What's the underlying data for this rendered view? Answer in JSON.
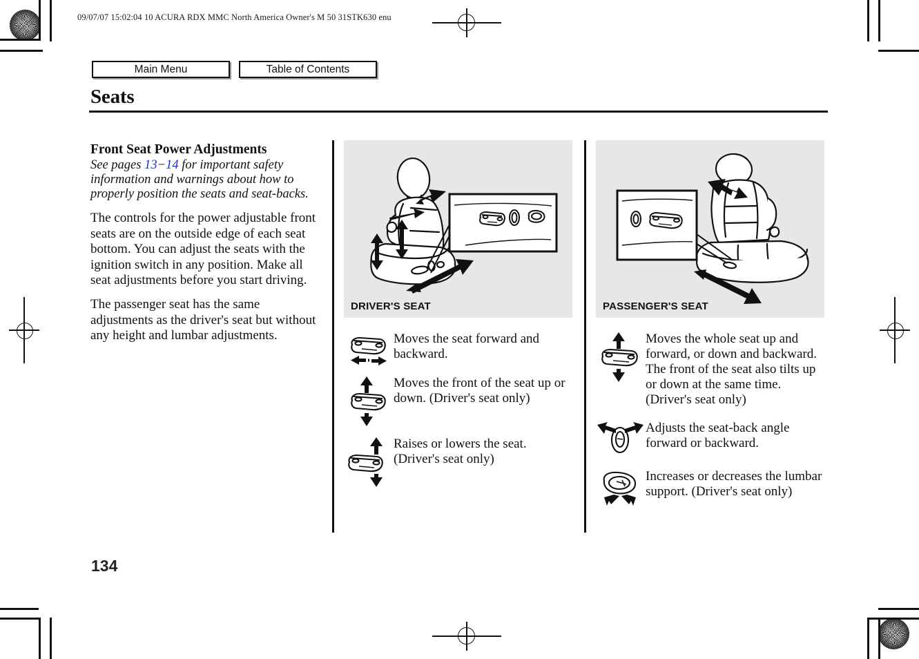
{
  "print_header": {
    "code_line": "09/07/07 15:02:04    10 ACURA RDX MMC North America Owner's M 50 31STK630 enu"
  },
  "nav": {
    "main_menu_label": "Main Menu",
    "table_of_contents_label": "Table of Contents"
  },
  "page": {
    "title": "Seats",
    "number": "134"
  },
  "left_column": {
    "section_heading": "Front Seat Power Adjustments",
    "safety_note": {
      "prefix": "See pages ",
      "page_link_1": "13",
      "dash": "−",
      "page_link_2": "14",
      "suffix": " for important safety information and warnings about how to properly position the seats and seat-backs.",
      "link_color": "#1a2fd0"
    },
    "paragraph_1": "The controls for the power adjustable front seats are on the outside edge of each seat bottom. You can adjust the seats with the ignition switch in any position. Make all seat adjustments before you start driving.",
    "paragraph_2": "The passenger seat has the same adjustments as the driver's seat but without any height and lumbar adjustments."
  },
  "middle_column": {
    "illustration_caption": "DRIVER'S SEAT",
    "illustration_name": "drivers-seat-diagram",
    "panel_bg": "#e7e7e7",
    "controls": [
      {
        "icon": "slide-switch-forward-backward-icon",
        "text": "Moves the seat forward and backward."
      },
      {
        "icon": "slide-switch-front-tilt-icon",
        "text": "Moves the front of the seat up or down. (Driver's seat only)"
      },
      {
        "icon": "slide-switch-height-icon",
        "text": "Raises or lowers the seat. (Driver's seat only)"
      }
    ]
  },
  "right_column": {
    "illustration_caption": "PASSENGER'S SEAT",
    "illustration_name": "passengers-seat-diagram",
    "panel_bg": "#e7e7e7",
    "controls": [
      {
        "icon": "slide-switch-whole-seat-icon",
        "text": "Moves the whole seat up and forward, or down and backward. The front of the seat also tilts up or down at the same time. (Driver's seat only)"
      },
      {
        "icon": "recline-switch-icon",
        "text": "Adjusts the seat-back angle forward or backward."
      },
      {
        "icon": "lumbar-switch-icon",
        "text": "Increases or decreases the lumbar support. (Driver's seat only)"
      }
    ]
  }
}
